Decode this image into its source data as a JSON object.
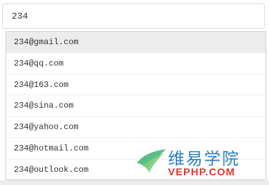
{
  "input": {
    "value": "234"
  },
  "suggestions": [
    "234@gmail.com",
    "234@qq.com",
    "234@163.com",
    "234@sina.com",
    "234@yahoo.com",
    "234@hotmail.com",
    "234@outlook.com"
  ],
  "watermark": {
    "cn_text": "维易学院",
    "en_text": "VEPHP.COM"
  },
  "colors": {
    "active_row": "#ececec",
    "watermark_blue": "#2a7fd0",
    "watermark_red": "#e23a2e",
    "watermark_green": "#3cb371"
  }
}
